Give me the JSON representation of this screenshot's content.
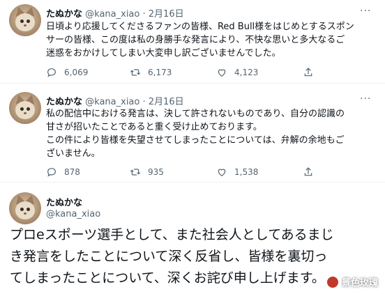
{
  "tweets": [
    {
      "name": "たぬかな",
      "handle": "@kana_xiao",
      "sep": "·",
      "date": "2月16日",
      "more": "···",
      "lines": [
        "日頃より応援してくださるファンの皆様、Red Bull様をはじめとするスポン",
        "サーの皆様、この度は私の身勝手な発言により、不快な思いと多大なるご",
        "迷惑をおかけしてしまい大変申し訳ございませんでした。"
      ],
      "replies": "6,069",
      "retweets": "6,173",
      "likes": "4,123"
    },
    {
      "name": "たぬかな",
      "handle": "@kana_xiao",
      "sep": "·",
      "date": "2月16日",
      "more": "···",
      "lines": [
        "私の配信中における発言は、決して許されないものであり、自分の認識の",
        "甘さが招いたことであると重く受け止めております。",
        "この件により皆様を失望させてしまったことについては、弁解の余地もご",
        "ざいません。"
      ],
      "replies": "878",
      "retweets": "935",
      "likes": "1,538"
    }
  ],
  "big_tweet": {
    "name": "たぬかな",
    "handle": "@kana_xiao",
    "lines": [
      "プロeスポーツ選手として、また社会人としてあるまじ",
      "き発言をしたことについて深く反省し、皆様を裏切っ",
      "てしまったことについて、深くお詫び申し上げます。"
    ]
  },
  "watermark": {
    "text": "景色玫瑰"
  },
  "icons": [
    "reply-icon",
    "retweet-icon",
    "like-icon",
    "share-icon",
    "more-icon"
  ]
}
